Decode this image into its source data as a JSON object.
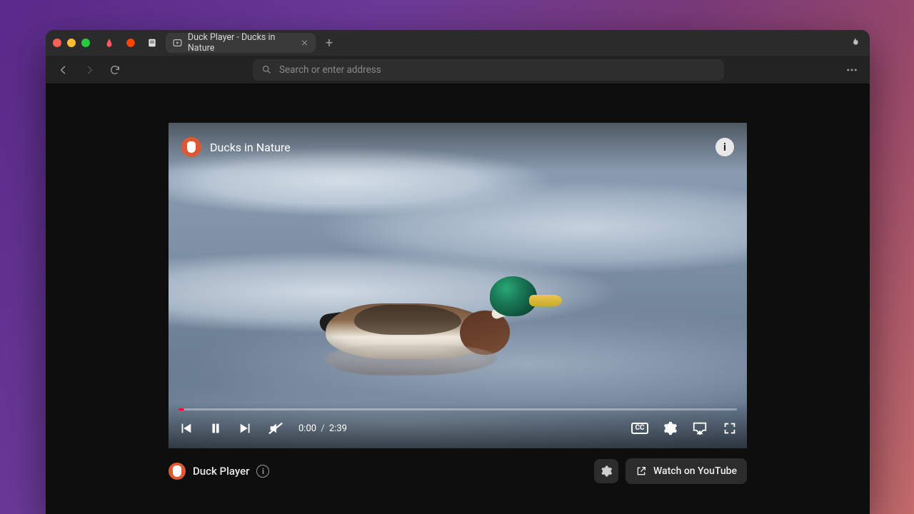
{
  "tabs": {
    "pinned": [
      "airbnb",
      "reddit",
      "notes"
    ],
    "active_title": "Duck Player - Ducks in Nature"
  },
  "toolbar": {
    "address_placeholder": "Search or enter address"
  },
  "video": {
    "title": "Ducks in Nature",
    "current_time": "0:00",
    "duration": "2:39",
    "time_separator": "/",
    "cc_label": "CC"
  },
  "under": {
    "brand": "Duck Player",
    "watch_label": "Watch on YouTube"
  }
}
